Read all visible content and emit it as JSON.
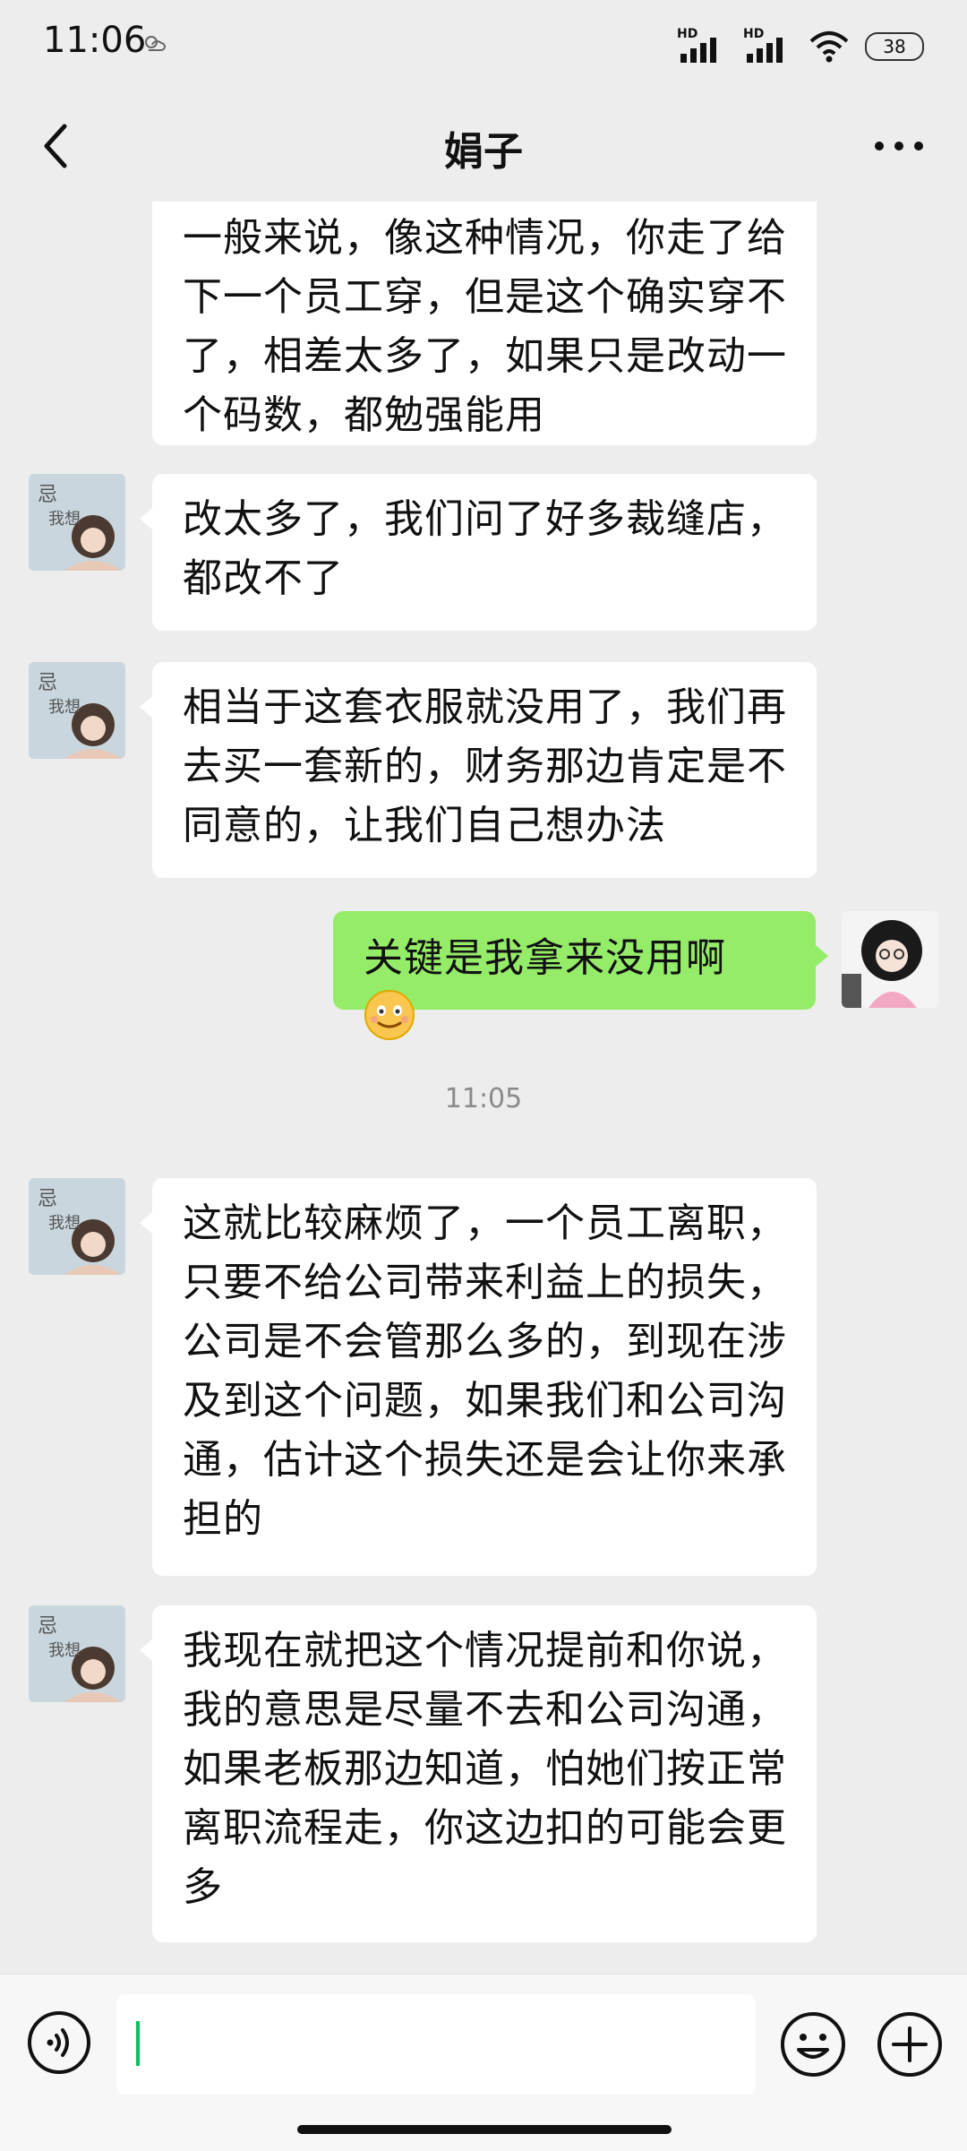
{
  "status_bar": {
    "time": "11:06",
    "battery": "38",
    "hd1": "HD",
    "hd2": "HD"
  },
  "header": {
    "title": "娟子"
  },
  "messages": [
    {
      "side": "in",
      "text": "一般来说，像这种情况，你走了给下一个员工穿，但是这个确实穿不了，相差太多了，如果只是改动一个码数，都勉强能用"
    },
    {
      "side": "in",
      "text": "改太多了，我们问了好多裁缝店，都改不了"
    },
    {
      "side": "in",
      "text": "相当于这套衣服就没用了，我们再去买一套新的，财务那边肯定是不同意的，让我们自己想办法"
    },
    {
      "side": "out",
      "text": "关键是我拿来没用啊",
      "emoji": "smile-emoji-icon"
    },
    {
      "type": "timestamp",
      "text": "11:05"
    },
    {
      "side": "in",
      "text": "这就比较麻烦了，一个员工离职，只要不给公司带来利益上的损失，公司是不会管那么多的，到现在涉及到这个问题，如果我们和公司沟通，估计这个损失还是会让你来承担的"
    },
    {
      "side": "in",
      "text": "我现在就把这个情况提前和你说，我的意思是尽量不去和公司沟通，如果老板那边知道，怕她们按正常离职流程走，你这边扣的可能会更多"
    }
  ],
  "input": {
    "value": "",
    "placeholder": ""
  },
  "colors": {
    "background": "#ededed",
    "incoming_bubble": "#ffffff",
    "outgoing_bubble": "#95ec69",
    "cursor": "#07c160"
  },
  "icons": {
    "back": "chevron-left-icon",
    "more": "more-dots-icon",
    "voice": "voice-icon",
    "emoji": "emoji-icon",
    "plus": "plus-icon"
  }
}
